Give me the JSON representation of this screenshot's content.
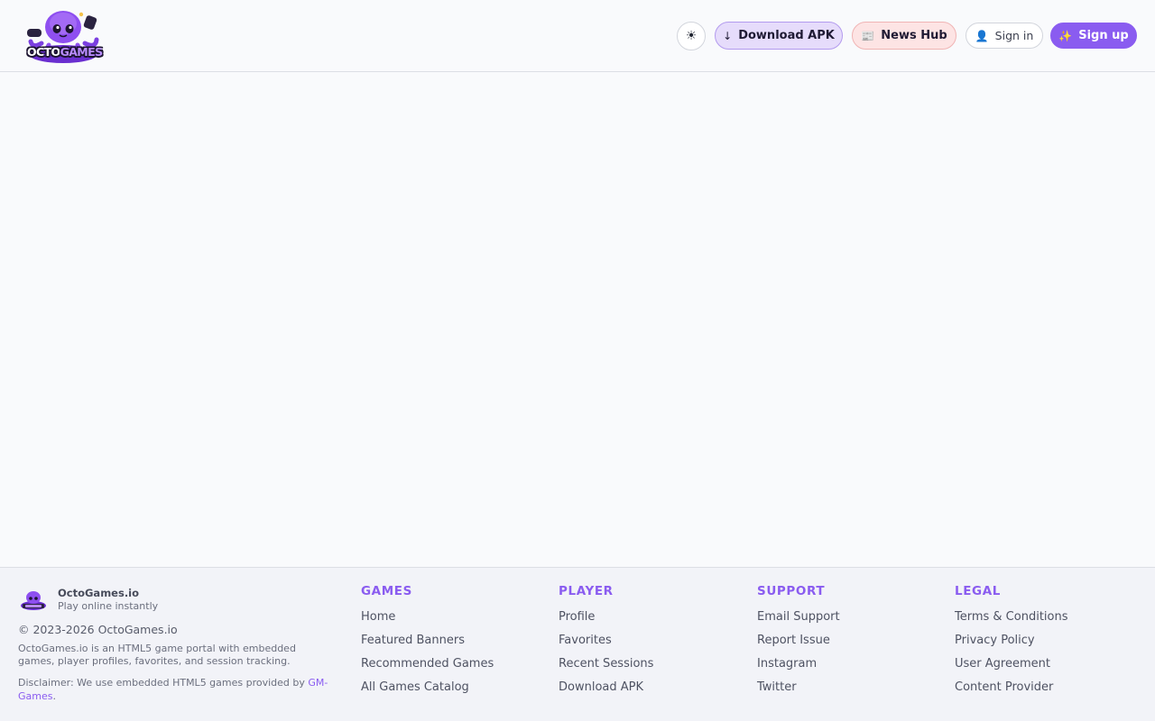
{
  "header": {
    "logo_text_a": "OCTO",
    "logo_text_b": "GAMES",
    "theme_icon": "☀",
    "download_apk": {
      "icon": "↓",
      "label": "Download APK"
    },
    "news_hub": {
      "icon": "📰",
      "label": "News Hub"
    },
    "sign_in": {
      "icon": "👤",
      "label": "Sign in"
    },
    "sign_up": {
      "icon": "✨",
      "label": "Sign up"
    }
  },
  "footer": {
    "brand_name": "OctoGames.io",
    "tagline": "Play online instantly",
    "copyright": "© 2023-2026 OctoGames.io",
    "description": "OctoGames.io is an HTML5 game portal with embedded games, player profiles, favorites, and session tracking.",
    "disclaimer_prefix": "Disclaimer: We use embedded HTML5 games provided by ",
    "disclaimer_link": "GM-Games",
    "disclaimer_suffix": ".",
    "columns": [
      {
        "title": "GAMES",
        "links": [
          "Home",
          "Featured Banners",
          "Recommended Games",
          "All Games Catalog"
        ]
      },
      {
        "title": "PLAYER",
        "links": [
          "Profile",
          "Favorites",
          "Recent Sessions",
          "Download APK"
        ]
      },
      {
        "title": "SUPPORT",
        "links": [
          "Email Support",
          "Report Issue",
          "Instagram",
          "Twitter"
        ]
      },
      {
        "title": "LEGAL",
        "links": [
          "Terms & Conditions",
          "Privacy Policy",
          "User Agreement",
          "Content Provider"
        ]
      }
    ]
  },
  "colors": {
    "accent": "#8a5cf0",
    "apk_bg": "#e6dcfb",
    "news_bg": "#fde4e4",
    "page_bg": "#f9fafc",
    "footer_bg": "#f2f3f8"
  }
}
